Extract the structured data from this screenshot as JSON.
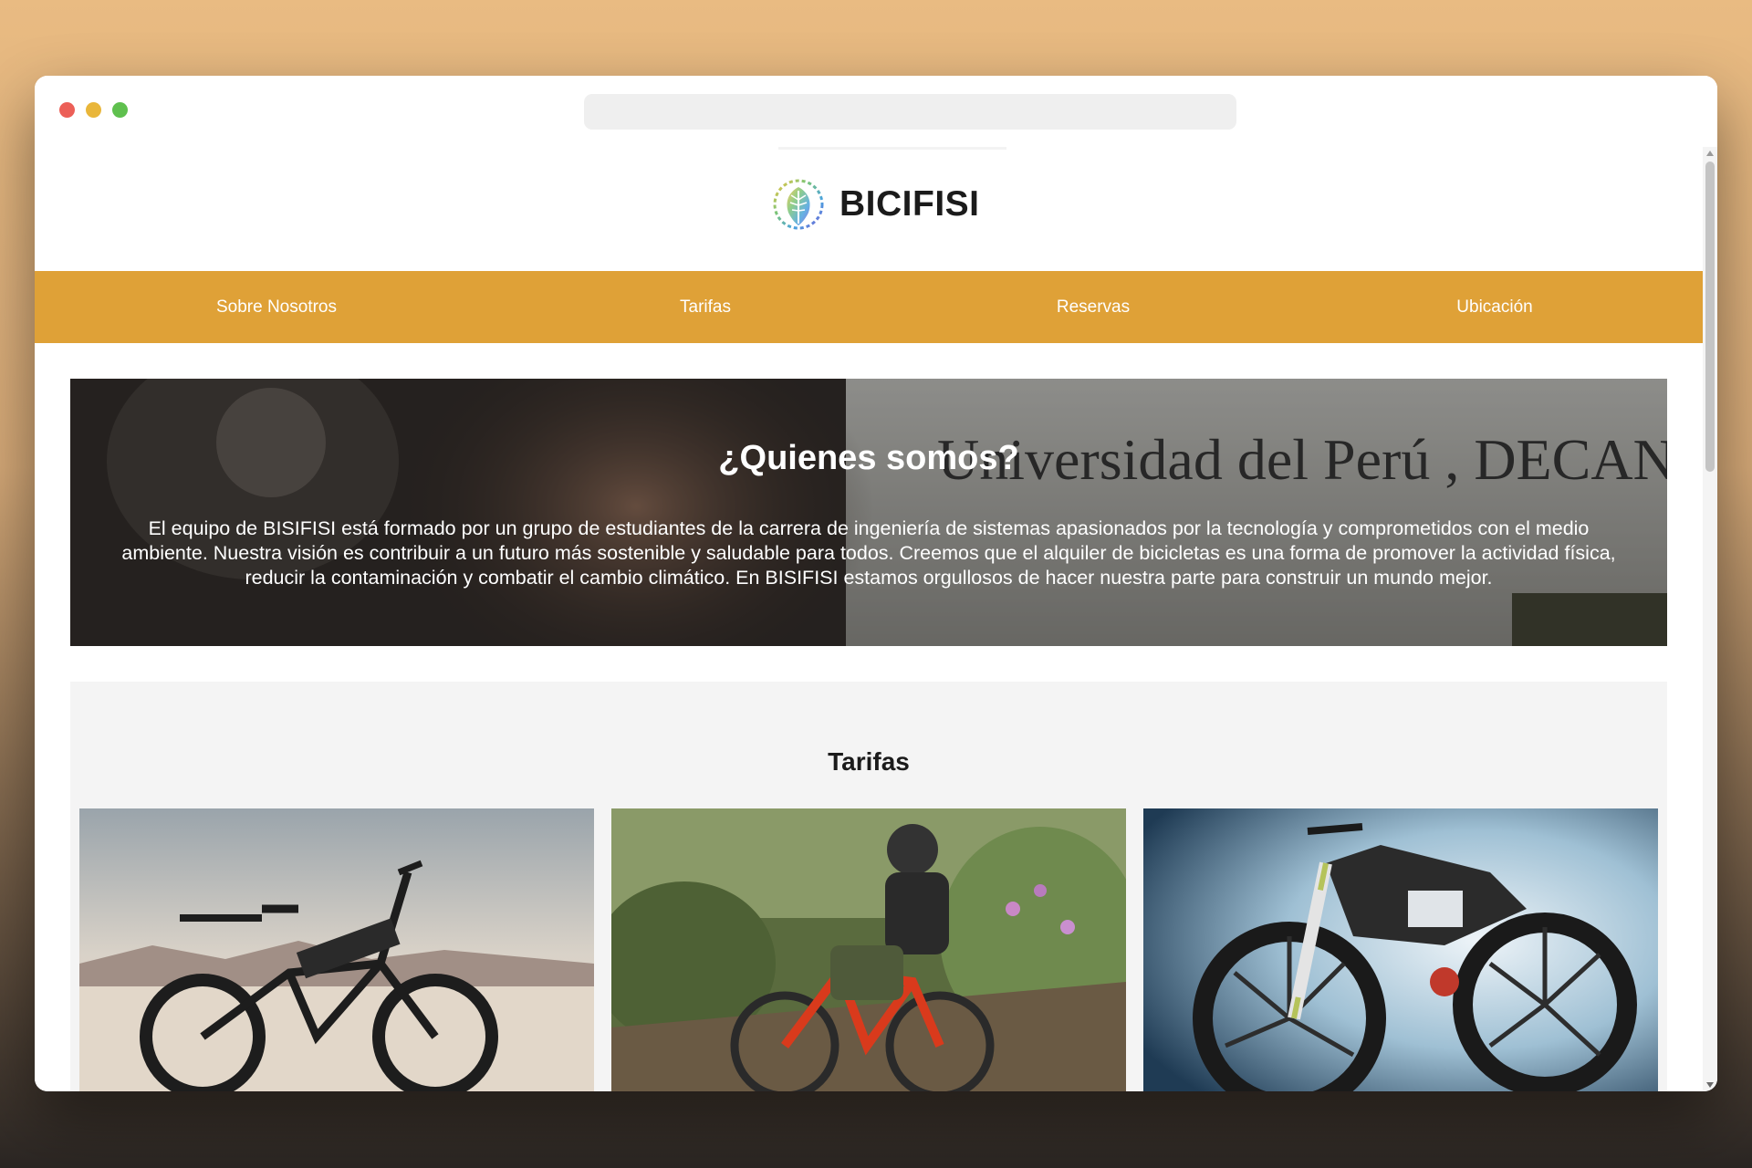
{
  "browser": {
    "address": ""
  },
  "site": {
    "brand_name": "BICIFISI",
    "logo_icon": "tree-leaf-logo-icon"
  },
  "nav": {
    "items": [
      {
        "label": "Sobre Nosotros"
      },
      {
        "label": "Tarifas"
      },
      {
        "label": "Reservas"
      },
      {
        "label": "Ubicación"
      }
    ]
  },
  "about": {
    "title": "¿Quienes somos?",
    "text": "El equipo de BISIFISI está formado por un grupo de estudiantes de la carrera de ingeniería de sistemas apasionados por la tecnología y comprometidos con el medio ambiente. Nuestra visión es contribuir a un futuro más sostenible y saludable para todos. Creemos que el alquiler de bicicletas es una forma de promover la actividad física, reducir la contaminación y combatir el cambio climático. En BISIFISI estamos orgullosos de hacer nuestra parte para construir un mundo mejor.",
    "background_sign_text": "Universidad del Perú , DECANA DE AMÉRICA"
  },
  "pricing": {
    "title": "Tarifas",
    "cards": [
      {
        "image": "e-bike-desert-photo"
      },
      {
        "image": "mountain-bike-rider-forest-photo"
      },
      {
        "image": "concept-e-bike-studio-photo"
      }
    ]
  },
  "colors": {
    "nav_background": "#dfa137",
    "section_background": "#f4f4f4"
  }
}
